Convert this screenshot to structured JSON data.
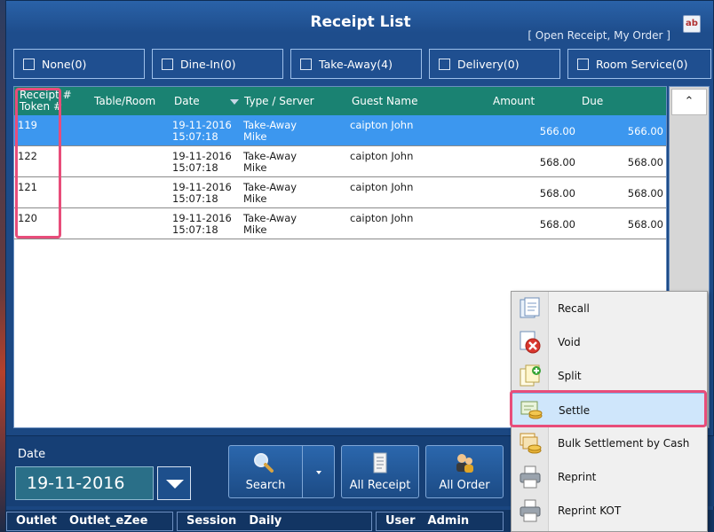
{
  "window": {
    "title": "Receipt List",
    "subtitle": "[ Open Receipt, My Order ]",
    "spell_icon": "ab"
  },
  "filters": [
    {
      "label": "None(0)"
    },
    {
      "label": "Dine-In(0)"
    },
    {
      "label": "Take-Away(4)"
    },
    {
      "label": "Delivery(0)"
    },
    {
      "label": "Room Service(0)"
    }
  ],
  "grid": {
    "columns": {
      "receipt_line1": "Receipt #",
      "receipt_line2": "Token #",
      "table_room": "Table/Room",
      "date": "Date",
      "type_server": "Type / Server",
      "guest_name": "Guest Name",
      "amount": "Amount",
      "due": "Due"
    },
    "rows": [
      {
        "receipt": "119",
        "date": "19-11-2016",
        "time": "15:07:18",
        "type": "Take-Away",
        "server": "Mike",
        "guest": "caipton John",
        "amount": "566.00",
        "due": "566.00"
      },
      {
        "receipt": "122",
        "date": "19-11-2016",
        "time": "15:07:18",
        "type": "Take-Away",
        "server": "Mike",
        "guest": "caipton John",
        "amount": "568.00",
        "due": "568.00"
      },
      {
        "receipt": "121",
        "date": "19-11-2016",
        "time": "15:07:18",
        "type": "Take-Away",
        "server": "Mike",
        "guest": "caipton John",
        "amount": "568.00",
        "due": "568.00"
      },
      {
        "receipt": "120",
        "date": "19-11-2016",
        "time": "15:07:18",
        "type": "Take-Away",
        "server": "Mike",
        "guest": "caipton John",
        "amount": "568.00",
        "due": "568.00"
      }
    ],
    "selected_row": 0,
    "scroll_up": "⌃"
  },
  "bottom": {
    "date_label": "Date",
    "date_value": "19-11-2016",
    "search_label": "Search",
    "all_receipt_label": "All Receipt",
    "all_order_label": "All Order"
  },
  "status": {
    "outlet_label": "Outlet",
    "outlet_value": "Outlet_eZee",
    "session_label": "Session",
    "session_value": "Daily",
    "user_label": "User",
    "user_value": "Admin"
  },
  "context_menu": {
    "items": [
      {
        "label": "Recall",
        "icon": "recall-icon"
      },
      {
        "label": "Void",
        "icon": "void-icon"
      },
      {
        "label": "Split",
        "icon": "split-icon"
      },
      {
        "label": "Settle",
        "icon": "settle-icon"
      },
      {
        "label": "Bulk Settlement by Cash",
        "icon": "bulk-settlement-icon"
      },
      {
        "label": "Reprint",
        "icon": "printer-icon"
      },
      {
        "label": "Reprint KOT",
        "icon": "printer-icon"
      }
    ],
    "active_index": 3
  },
  "colors": {
    "window_blue": "#1e4d8c",
    "header_teal": "#1a8272",
    "selected_row": "#3c97ef",
    "highlight_pink": "#e84d7a"
  }
}
